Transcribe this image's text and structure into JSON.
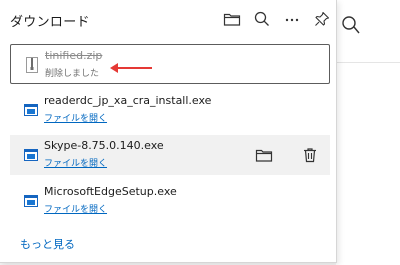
{
  "panel": {
    "title": "ダウンロード",
    "header_icons": [
      "folder-icon",
      "search-icon",
      "more-icon",
      "pin-icon"
    ]
  },
  "downloads": [
    {
      "name": "tinified.zip",
      "status": "削除しました",
      "state": "deleted",
      "icon": "zip-file-icon"
    },
    {
      "name": "readerdc_jp_xa_cra_install.exe",
      "link": "ファイルを開く",
      "icon": "exe-file-icon"
    },
    {
      "name": "Skype-8.75.0.140.exe",
      "link": "ファイルを開く",
      "icon": "exe-file-icon",
      "actions": [
        "folder-icon",
        "delete-icon"
      ]
    },
    {
      "name": "MicrosoftEdgeSetup.exe",
      "link": "ファイルを開く",
      "icon": "exe-file-icon"
    }
  ],
  "footer": {
    "more_label": "もっと見る"
  },
  "colors": {
    "link": "#0067c0",
    "annotation_arrow": "#e53935",
    "hover_bg": "#f1f1f1"
  }
}
